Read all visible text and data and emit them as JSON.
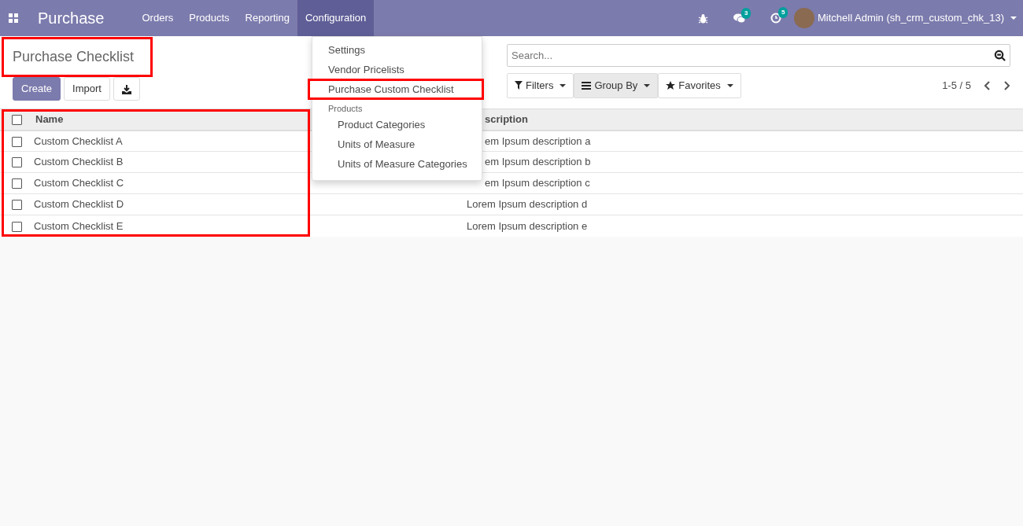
{
  "navbar": {
    "app_title": "Purchase",
    "menus": [
      {
        "label": "Orders",
        "selected": false
      },
      {
        "label": "Products",
        "selected": false
      },
      {
        "label": "Reporting",
        "selected": false
      },
      {
        "label": "Configuration",
        "selected": true
      }
    ],
    "systray": [
      {
        "kind": "debug"
      },
      {
        "kind": "messages",
        "badge": "3"
      },
      {
        "kind": "activities",
        "badge": "5"
      }
    ],
    "user": {
      "name": "Mitchell Admin (sh_crm_custom_chk_13)"
    }
  },
  "dropdown": {
    "items": [
      {
        "kind": "item",
        "label": "Settings"
      },
      {
        "kind": "item",
        "label": "Vendor Pricelists"
      },
      {
        "kind": "item",
        "label": "Purchase Custom Checklist"
      },
      {
        "kind": "header",
        "label": "Products"
      },
      {
        "kind": "subitem",
        "label": "Product Categories"
      },
      {
        "kind": "subitem",
        "label": "Units of Measure"
      },
      {
        "kind": "subitem",
        "label": "Units of Measure Categories"
      }
    ]
  },
  "control_panel": {
    "title": "Purchase Checklist",
    "buttons": [
      {
        "kind": "primary",
        "label": "Create"
      },
      {
        "kind": "secondary",
        "label": "Import"
      },
      {
        "kind": "download"
      }
    ],
    "search": {
      "placeholder": "Search..."
    },
    "filters": [
      {
        "kind": "filter",
        "label": "Filters",
        "selected": false
      },
      {
        "kind": "groupby",
        "label": "Group By",
        "selected": true
      },
      {
        "kind": "favorites",
        "label": "Favorites",
        "selected": false
      }
    ],
    "pager": "1-5 / 5"
  },
  "table": {
    "select_all": {
      "checked": false
    },
    "columns": [
      "Name",
      "scription"
    ],
    "rows": [
      {
        "checked": false,
        "name": "Custom Checklist A",
        "description": "em Ipsum description a"
      },
      {
        "checked": false,
        "name": "Custom Checklist B",
        "description": "em Ipsum description b"
      },
      {
        "checked": false,
        "name": "Custom Checklist C",
        "description": "em Ipsum description c"
      },
      {
        "checked": false,
        "name": "Custom Checklist D",
        "description": "Lorem Ipsum description d"
      },
      {
        "checked": false,
        "name": "Custom Checklist E",
        "description": "Lorem Ipsum description e"
      }
    ]
  },
  "annotations": [
    {
      "kind": "title"
    },
    {
      "kind": "menu-item"
    },
    {
      "kind": "name-column"
    }
  ]
}
